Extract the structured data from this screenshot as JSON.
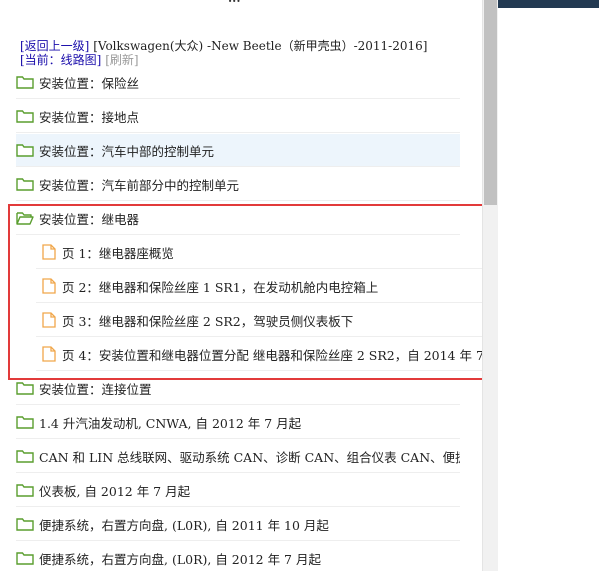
{
  "header": {
    "partial_title": "..."
  },
  "breadcrumb": {
    "back_link": "[返回上一级]",
    "path_text": "[Volkswagen(大众) -New Beetle（新甲壳虫）-2011-2016]",
    "current_label": "[当前：线路图]",
    "refresh_link": "[刷新]"
  },
  "tree": [
    {
      "type": "folder",
      "label": "安装位置：保险丝"
    },
    {
      "type": "folder",
      "label": "安装位置：接地点"
    },
    {
      "type": "folder",
      "label": "安装位置：汽车中部的控制单元"
    },
    {
      "type": "folder",
      "label": "安装位置：汽车前部分中的控制单元"
    },
    {
      "type": "folder-open",
      "label": "安装位置：继电器"
    },
    {
      "type": "doc",
      "label": "页 1：继电器座概览"
    },
    {
      "type": "doc",
      "label": "页 2：继电器和保险丝座 1 SR1，在发动机舱内电控箱上"
    },
    {
      "type": "doc",
      "label": "页 3：继电器和保险丝座 2 SR2，驾驶员侧仪表板下"
    },
    {
      "type": "doc",
      "label": "页 4：安装位置和继电器位置分配 继电器和保险丝座 2 SR2，自 2014 年 7"
    },
    {
      "type": "folder",
      "label": "安装位置：连接位置"
    },
    {
      "type": "folder",
      "label": "1.4 升汽油发动机, CNWA, 自 2012 年 7 月起"
    },
    {
      "type": "folder",
      "label": "CAN 和 LIN 总线联网、驱动系统 CAN、诊断 CAN、组合仪表 CAN、便捷功能"
    },
    {
      "type": "folder",
      "label": "仪表板, 自 2012 年 7 月起"
    },
    {
      "type": "folder",
      "label": "便捷系统，右置方向盘, (L0R), 自 2011 年 10 月起"
    },
    {
      "type": "folder",
      "label": "便捷系统，右置方向盘, (L0R), 自 2012 年 7 月起"
    }
  ],
  "colors": {
    "folder_green": "#5a9e2f",
    "doc_orange": "#f0a64a",
    "highlight_row": "#edf5fc",
    "annotation_red": "#e23a3a",
    "link_blue": "#1a0dab",
    "panel_dark": "#233a52"
  }
}
